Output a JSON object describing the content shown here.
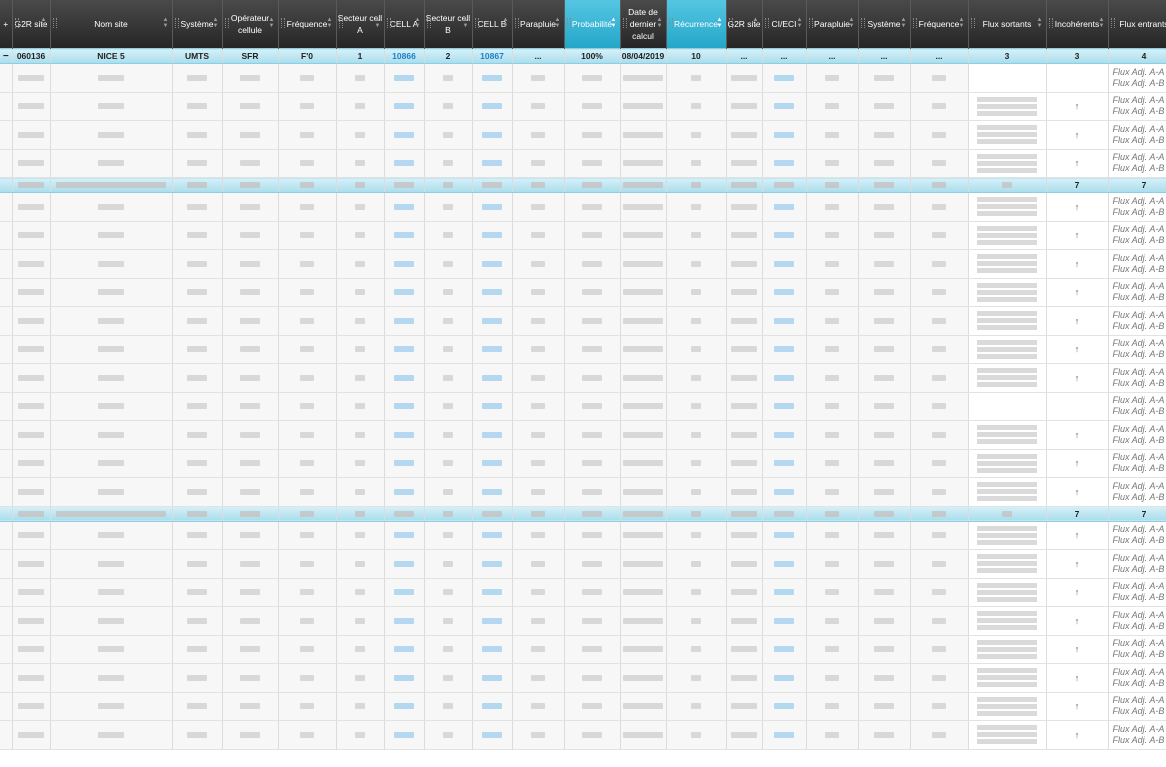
{
  "columns": [
    {
      "key": "toggle",
      "label": "+"
    },
    {
      "key": "g2r_site",
      "label": "G2R site"
    },
    {
      "key": "nom_site",
      "label": "Nom site"
    },
    {
      "key": "systeme",
      "label": "Système"
    },
    {
      "key": "operateur",
      "label": "Opérateur cellule"
    },
    {
      "key": "frequence",
      "label": "Fréquence"
    },
    {
      "key": "secteur_a",
      "label": "Secteur cell A"
    },
    {
      "key": "cell_a",
      "label": "CELL A"
    },
    {
      "key": "secteur_b",
      "label": "Secteur cell B"
    },
    {
      "key": "cell_b",
      "label": "CELL B"
    },
    {
      "key": "parapluie",
      "label": "Parapluie"
    },
    {
      "key": "probabilite",
      "label": "Probabilité",
      "sorted": true
    },
    {
      "key": "date_calcul",
      "label": "Date de dernier calcul"
    },
    {
      "key": "recurrence",
      "label": "Récurrence",
      "sorted": true
    },
    {
      "key": "g2r_site2",
      "label": "G2R site"
    },
    {
      "key": "ci_eci",
      "label": "CI/ECI"
    },
    {
      "key": "parapluie2",
      "label": "Parapluie"
    },
    {
      "key": "systeme2",
      "label": "Système"
    },
    {
      "key": "frequence2",
      "label": "Fréquence"
    },
    {
      "key": "flux_sortants",
      "label": "Flux sortants"
    },
    {
      "key": "incoherents",
      "label": "Incohérents"
    },
    {
      "key": "flux_entrants",
      "label": "Flux entrants"
    }
  ],
  "first_group": {
    "toggle": "−",
    "g2r_site": "060136",
    "nom_site": "NICE 5",
    "systeme": "UMTS",
    "operateur": "SFR",
    "frequence": "F'0",
    "secteur_a": "1",
    "cell_a": "10866",
    "secteur_b": "2",
    "cell_b": "10867",
    "parapluie": "...",
    "probabilite": "100%",
    "date_calcul": "08/04/2019",
    "recurrence": "10",
    "g2r_site2": "...",
    "ci_eci": "...",
    "parapluie2": "...",
    "systeme2": "...",
    "frequence2": "...",
    "flux_sortants": "3",
    "incoherents": "3",
    "flux_entrants": "4"
  },
  "groups_summary": [
    {
      "incoherents": "7",
      "flux_entrants": "7"
    },
    {
      "incoherents": "7",
      "flux_entrants": "7"
    }
  ],
  "flux_labels": {
    "aa": "Flux Adj. A-A :",
    "ab": "Flux Adj. A-B :"
  },
  "incoherent_mark": "↑"
}
